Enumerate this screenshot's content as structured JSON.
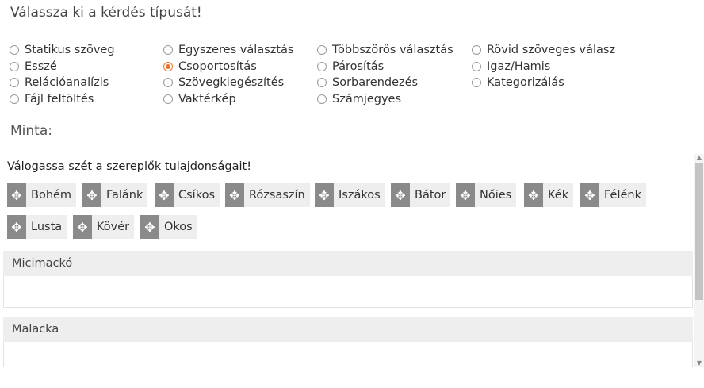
{
  "title": "Válassza ki a kérdés típusát!",
  "question_types": [
    {
      "label": "Statikus szöveg",
      "checked": false
    },
    {
      "label": "Egyszeres választás",
      "checked": false
    },
    {
      "label": "Többszörös választás",
      "checked": false
    },
    {
      "label": "Rövid szöveges válasz",
      "checked": false
    },
    {
      "label": "Esszé",
      "checked": false
    },
    {
      "label": "Csoportosítás",
      "checked": true
    },
    {
      "label": "Párosítás",
      "checked": false
    },
    {
      "label": "Igaz/Hamis",
      "checked": false
    },
    {
      "label": "Relációanalízis",
      "checked": false
    },
    {
      "label": "Szövegkiegészítés",
      "checked": false
    },
    {
      "label": "Sorbarendezés",
      "checked": false
    },
    {
      "label": "Kategorizálás",
      "checked": false
    },
    {
      "label": "Fájl feltöltés",
      "checked": false
    },
    {
      "label": "Vaktérkép",
      "checked": false
    },
    {
      "label": "Számjegyes",
      "checked": false
    }
  ],
  "sample_label": "Minta:",
  "sample": {
    "instruction": "Válogassa szét a szereplők tulajdonságait!",
    "items": [
      "Bohém",
      "Falánk",
      "Csíkos",
      "Rózsaszín",
      "Iszákos",
      "Bátor",
      "Nőies",
      "Kék",
      "Félénk",
      "Lusta",
      "Kövér",
      "Okos"
    ],
    "groups": [
      "Micimackó",
      "Malacka"
    ]
  },
  "colors": {
    "accent": "#e8772e",
    "handle": "#8a8a8a",
    "chip_bg": "#eeeeee"
  },
  "icons": {
    "drag_handle": "move-arrows-icon"
  }
}
